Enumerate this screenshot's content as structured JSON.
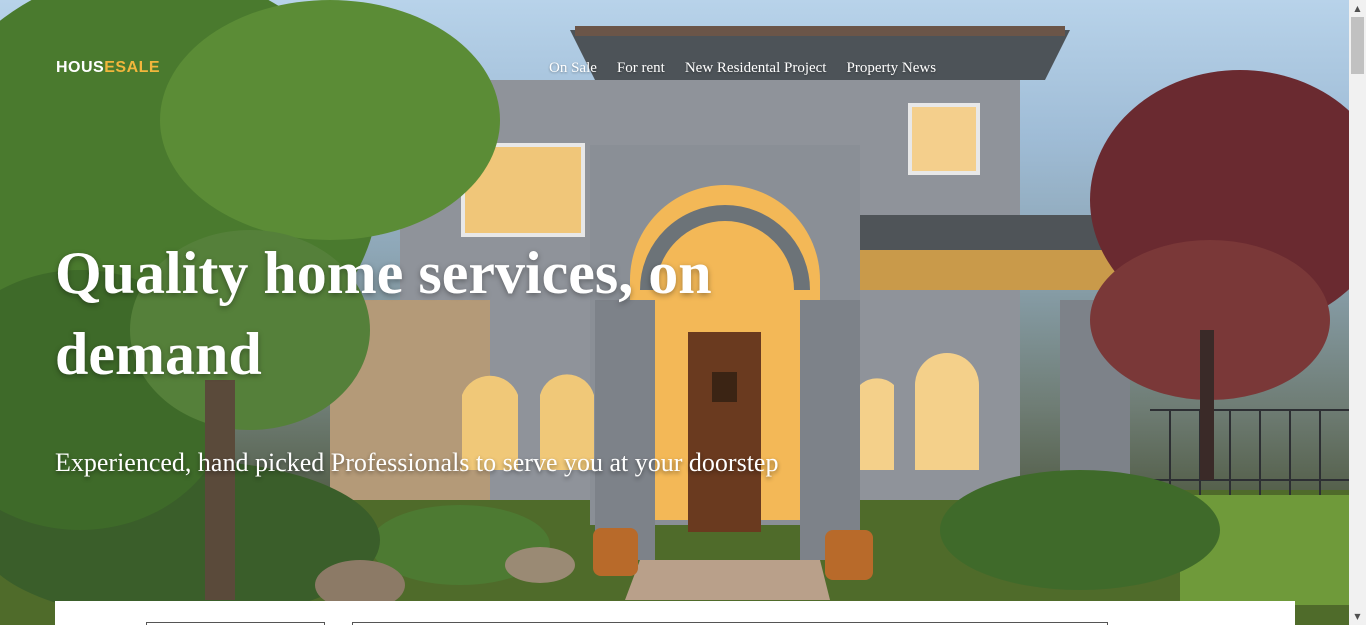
{
  "header": {
    "logo": {
      "part1": "HOUS",
      "part2": "ESALE"
    },
    "nav": [
      {
        "label": "On Sale"
      },
      {
        "label": "For rent"
      },
      {
        "label": "New Residental Project"
      },
      {
        "label": "Property News"
      }
    ]
  },
  "hero": {
    "title": "Quality home services, on demand",
    "subtitle": "Experienced, hand picked Professionals to serve you at your doorstep"
  },
  "colors": {
    "accent": "#f2b63c",
    "text": "#ffffff"
  },
  "icons": {
    "scroll_up": "triangle-up-icon",
    "scroll_down": "triangle-down-icon"
  }
}
